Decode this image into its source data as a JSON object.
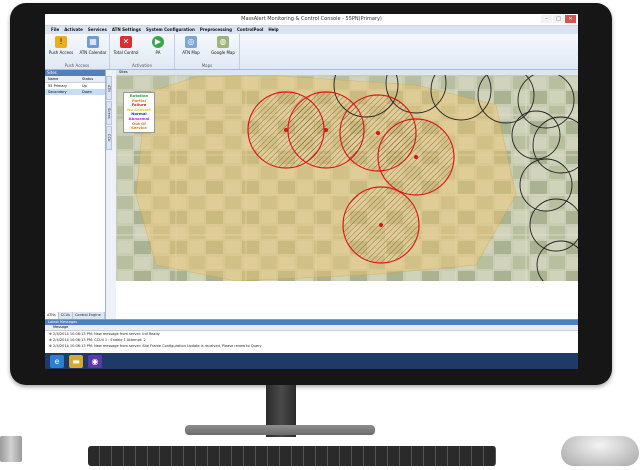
{
  "window": {
    "title": "MassAlert Monitoring & Control Console - 55PN(Primary)",
    "minimize": "–",
    "maximize": "□",
    "close": "✕"
  },
  "menu": [
    "File",
    "Activate",
    "Services",
    "ATN Settings",
    "System Configuration",
    "Preprocessing",
    "ControlPool",
    "Help"
  ],
  "ribbon": {
    "groups": [
      {
        "name": "Push Access",
        "buttons": [
          {
            "label": "Push Access",
            "icon": "warning-icon",
            "color": "#e8b020"
          },
          {
            "label": "ATN Calendar",
            "icon": "calendar-icon",
            "color": "#6c9bd6"
          }
        ]
      },
      {
        "name": "Activation",
        "buttons": [
          {
            "label": "Total Control",
            "icon": "x-icon",
            "color": "#d92f2f"
          },
          {
            "label": "PA",
            "icon": "play-icon",
            "color": "#3aa54a"
          }
        ]
      },
      {
        "name": "Maps",
        "buttons": [
          {
            "label": "ATN Map",
            "icon": "map-icon",
            "color": "#7aa7d8"
          },
          {
            "label": "Google Map",
            "icon": "globe-icon",
            "color": "#9fb27a"
          }
        ]
      }
    ]
  },
  "left_panel": {
    "title": "Sites",
    "columns": [
      "Name",
      "Status"
    ],
    "rows": [
      {
        "name": "55 Primary",
        "status": "Up"
      },
      {
        "name": "Secondary",
        "status": "Down"
      }
    ],
    "tabs": [
      "ATNs",
      "CCUs",
      "Control Engine Queue"
    ]
  },
  "vertical_tabs": [
    "ATN",
    "Sirens",
    "CCU"
  ],
  "map": {
    "tab": "Sites",
    "legend": [
      {
        "label": "Rotation",
        "color": "#2aa33a"
      },
      {
        "label": "Partial",
        "color": "#e07a1a"
      },
      {
        "label": "Failure",
        "color": "#e01414"
      },
      {
        "label": "No Contact",
        "color": "#e0c81a"
      },
      {
        "label": "Normal",
        "color": "#1a2ae0"
      },
      {
        "label": "Abnormal",
        "color": "#c01ac0"
      },
      {
        "label": "Out Of Service",
        "color": "#e07a1a"
      }
    ]
  },
  "messages": {
    "title": "Latest Messages",
    "column": "Message",
    "rows": [
      "2/4/2014 10:06:13 PM: New message from server: Ind Ready",
      "2/4/2014 10:06:13 PM: CCU4 1 : Enable 1  Attempt: 2",
      "2/4/2014 10:06:13 PM: New message from server: Site Frame Configuration Update is received, Please renew to Query"
    ]
  },
  "taskbar": [
    {
      "icon": "ie-icon",
      "color": "#2a7fd6",
      "glyph": "e"
    },
    {
      "icon": "folder-icon",
      "color": "#d8a833",
      "glyph": "▬"
    },
    {
      "icon": "app-icon",
      "color": "#5a3aa8",
      "glyph": "◉"
    }
  ]
}
